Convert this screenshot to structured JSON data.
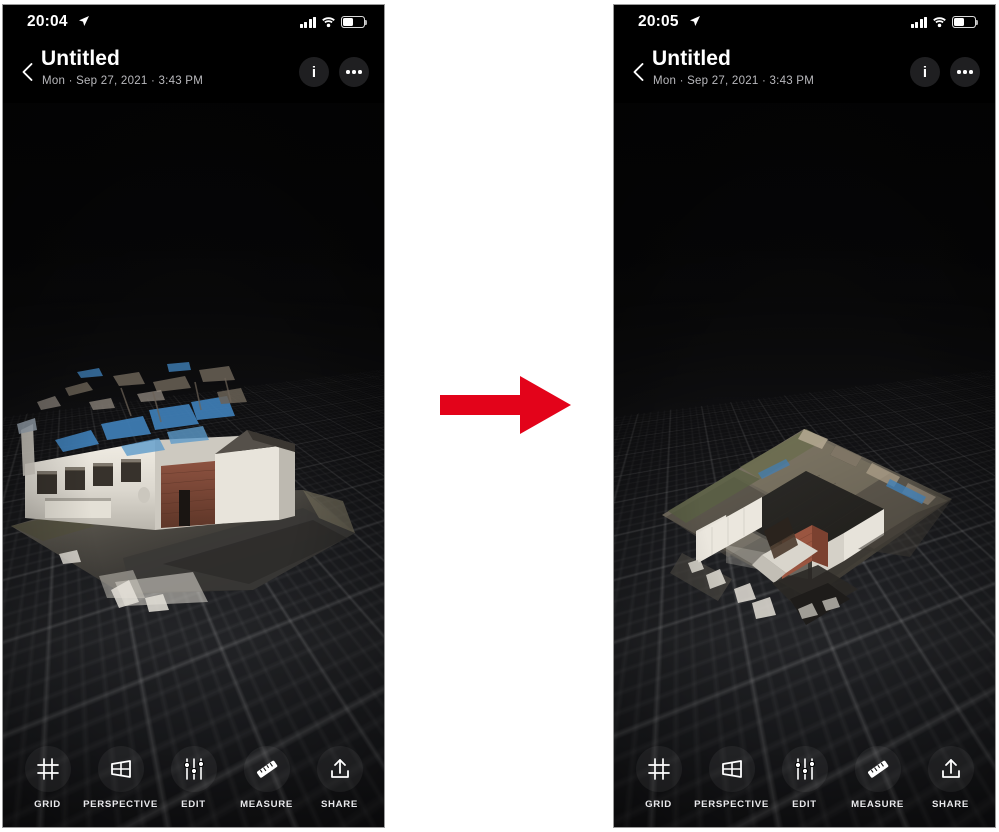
{
  "panels": [
    {
      "id": "before",
      "status_bar": {
        "time": "20:04",
        "location_icon": "location-arrow-icon",
        "signal_icon": "cellular-signal-icon",
        "wifi_icon": "wifi-icon",
        "battery_icon": "battery-icon",
        "battery_level_pct": 44
      },
      "header": {
        "back_icon": "back-chevron-icon",
        "title": "Untitled",
        "subtitle": "Mon · Sep 27, 2021 · 3:43 PM",
        "info_label": "i",
        "info_icon": "info-icon",
        "more_icon": "more-options-icon"
      },
      "viewport": {
        "scene": "3d-scan-side-view",
        "description": "3D photogrammetry scan of a damaged single-storey building viewed from a low side angle, white render facade with dark windows, brick wall section, blue tarpaulins over the collapsed roof, on a dark perspective grid floor"
      },
      "toolbar": [
        {
          "label": "GRID",
          "icon": "grid-icon"
        },
        {
          "label": "PERSPECTIVE",
          "icon": "perspective-icon"
        },
        {
          "label": "EDIT",
          "icon": "sliders-icon"
        },
        {
          "label": "MEASURE",
          "icon": "ruler-icon"
        },
        {
          "label": "SHARE",
          "icon": "share-upload-icon"
        }
      ]
    },
    {
      "id": "after",
      "status_bar": {
        "time": "20:05",
        "location_icon": "location-arrow-icon",
        "signal_icon": "cellular-signal-icon",
        "wifi_icon": "wifi-icon",
        "battery_icon": "battery-icon",
        "battery_level_pct": 44
      },
      "header": {
        "back_icon": "back-chevron-icon",
        "title": "Untitled",
        "subtitle": "Mon · Sep 27, 2021 · 3:43 PM",
        "info_label": "i",
        "info_icon": "info-icon",
        "more_icon": "more-options-icon"
      },
      "viewport": {
        "scene": "3d-scan-top-down-view",
        "description": "Same 3D scan rotated to a top-down aerial perspective showing the rectangular footprint, perimeter walls forming an open courtyard, brick and white wall segments and gravel ground"
      },
      "toolbar": [
        {
          "label": "GRID",
          "icon": "grid-icon"
        },
        {
          "label": "PERSPECTIVE",
          "icon": "perspective-icon"
        },
        {
          "label": "EDIT",
          "icon": "sliders-icon"
        },
        {
          "label": "MEASURE",
          "icon": "ruler-icon"
        },
        {
          "label": "SHARE",
          "icon": "share-upload-icon"
        }
      ]
    }
  ],
  "transition": {
    "icon": "right-arrow-icon",
    "color": "#E3031A"
  },
  "colors": {
    "background": "#ffffff",
    "panel_background": "#000000",
    "accent_red": "#E3031A",
    "title_text": "#ffffff",
    "subtitle_text": "#b9b9bd",
    "toolbar_label": "#e9e9ec"
  }
}
